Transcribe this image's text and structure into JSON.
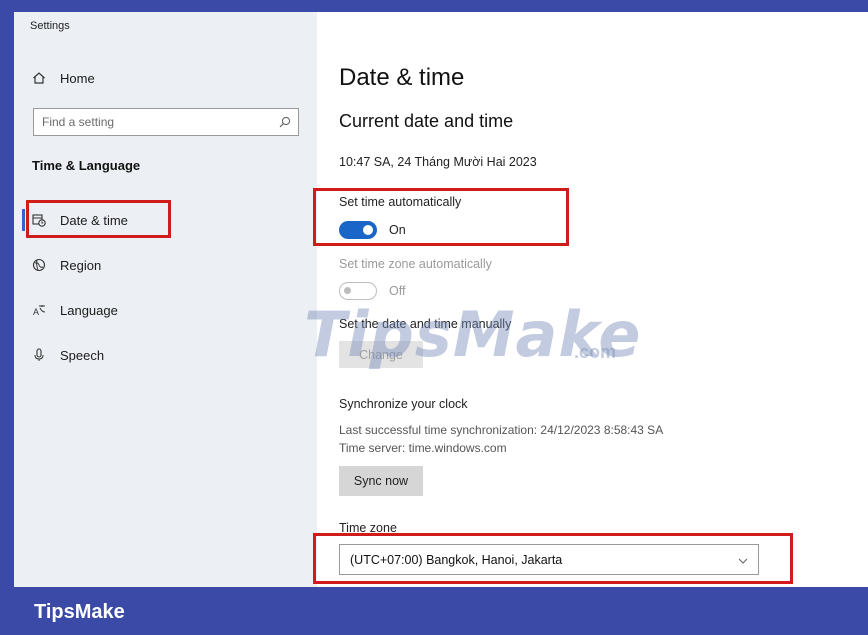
{
  "window": {
    "title": "Settings"
  },
  "sidebar": {
    "home_label": "Home",
    "search_placeholder": "Find a setting",
    "section_heading": "Time & Language",
    "items": [
      {
        "label": "Date & time",
        "icon": "calendar-clock-icon",
        "active": true
      },
      {
        "label": "Region",
        "icon": "globe-icon"
      },
      {
        "label": "Language",
        "icon": "language-icon"
      },
      {
        "label": "Speech",
        "icon": "microphone-icon"
      }
    ]
  },
  "main": {
    "title": "Date & time",
    "current_heading": "Current date and time",
    "current_value": "10:47 SA, 24 Tháng Mười Hai 2023",
    "set_time_auto": {
      "label": "Set time automatically",
      "state": "On"
    },
    "set_zone_auto": {
      "label": "Set time zone automatically",
      "state": "Off"
    },
    "manual": {
      "label": "Set the date and time manually",
      "button": "Change"
    },
    "sync": {
      "heading": "Synchronize your clock",
      "last_sync": "Last successful time synchronization: 24/12/2023 8:58:43 SA",
      "server": "Time server: time.windows.com",
      "button": "Sync now"
    },
    "timezone": {
      "label": "Time zone",
      "value": "(UTC+07:00) Bangkok, Hanoi, Jakarta"
    }
  },
  "watermark": {
    "text": "TipsMake",
    "suffix": ".com"
  },
  "brand": "TipsMake",
  "colors": {
    "accent": "#1a66c8",
    "highlight": "#d01b1b",
    "brand_bar": "#3b4aa7"
  }
}
